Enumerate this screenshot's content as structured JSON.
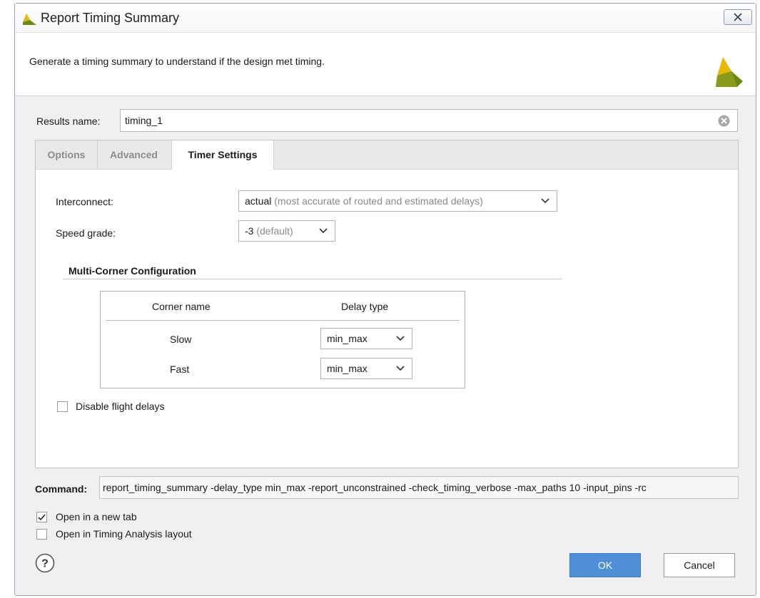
{
  "window": {
    "title": "Report Timing Summary",
    "logo_icon": "vivado-logo-icon",
    "close_icon": "close-icon"
  },
  "banner": {
    "description": "Generate a timing summary to understand if the design met timing."
  },
  "results": {
    "label": "Results name:",
    "value": "timing_1",
    "clear_icon": "clear-icon"
  },
  "tabs": [
    {
      "label": "Options",
      "active": false
    },
    {
      "label": "Advanced",
      "active": false
    },
    {
      "label": "Timer Settings",
      "active": true
    }
  ],
  "timer_settings": {
    "interconnect": {
      "label": "Interconnect:",
      "value": "actual",
      "hint": "(most accurate of routed and estimated delays)"
    },
    "speed_grade": {
      "label": "Speed grade:",
      "value": "-3",
      "hint": "(default)"
    },
    "multi_corner": {
      "title": "Multi-Corner Configuration",
      "headers": [
        "Corner name",
        "Delay type"
      ],
      "rows": [
        {
          "corner": "Slow",
          "delay_type": "min_max"
        },
        {
          "corner": "Fast",
          "delay_type": "min_max"
        }
      ]
    },
    "disable_flight_delays": {
      "label": "Disable flight delays",
      "checked": false
    }
  },
  "command": {
    "label": "Command:",
    "value": "report_timing_summary -delay_type min_max -report_unconstrained -check_timing_verbose -max_paths 10 -input_pins -rc"
  },
  "options": {
    "open_new_tab": {
      "label": "Open in a new tab",
      "checked": true
    },
    "open_timing_layout": {
      "label": "Open in Timing Analysis layout",
      "checked": false
    }
  },
  "buttons": {
    "help_icon": "help-icon",
    "ok": "OK",
    "cancel": "Cancel"
  },
  "colors": {
    "accent": "#4f8fd8",
    "brand_yellow": "#e6b800",
    "brand_green": "#8a9a1a"
  }
}
